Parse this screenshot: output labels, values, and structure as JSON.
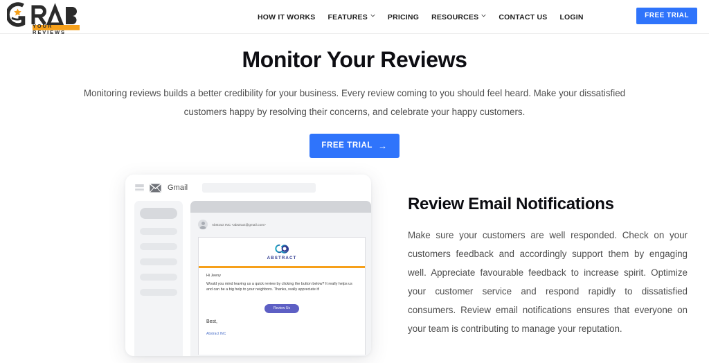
{
  "brand": {
    "name": "GRAB",
    "tagline": "YOUR REVIEWS"
  },
  "header": {
    "nav": [
      {
        "label": "HOW IT WORKS",
        "has_caret": false
      },
      {
        "label": "FEATURES",
        "has_caret": true
      },
      {
        "label": "PRICING",
        "has_caret": false
      },
      {
        "label": "RESOURCES",
        "has_caret": true
      },
      {
        "label": "CONTACT US",
        "has_caret": false
      },
      {
        "label": "LOGIN",
        "has_caret": false
      }
    ],
    "cta_label": "FREE TRIAL",
    "cta_color": "#2f74fb"
  },
  "hero": {
    "title": "Monitor Your Reviews",
    "subtitle": "Monitoring reviews builds a better credibility for your business. Every review coming to you should feel heard. Make your dissatisfied customers happy by resolving their concerns, and celebrate your happy customers.",
    "cta_label": "FREE TRIAL",
    "cta_arrow": "→",
    "cta_color": "#2f74fb"
  },
  "mockup": {
    "app_name": "Gmail",
    "search_placeholder": "",
    "sender": "Abstract INC <abstract@gmail.com>",
    "email": {
      "brand": "ABSTRACT",
      "accent_color": "#f6a01a",
      "greeting": "Hi Jeeny",
      "body": "Would you mind leaving us a quick review by clicking the button below? It really helps us and can be a big help to your neighbors. Thanks, really appreciate it!",
      "button_label": "Review Us",
      "button_color": "#5d5fc4",
      "signoff": "Best,",
      "signature": "Abstract INC"
    }
  },
  "section": {
    "title": "Review Email Notifications",
    "paragraph": "Make sure your customers are well responded. Check on your customers feedback and accordingly support them by engaging well. Appreciate favourable feedback to increase spirit. Optimize your customer service and respond rapidly to dissatisfied consumers. Review email notifications ensures that everyone on your team is contributing to manage your reputation."
  }
}
